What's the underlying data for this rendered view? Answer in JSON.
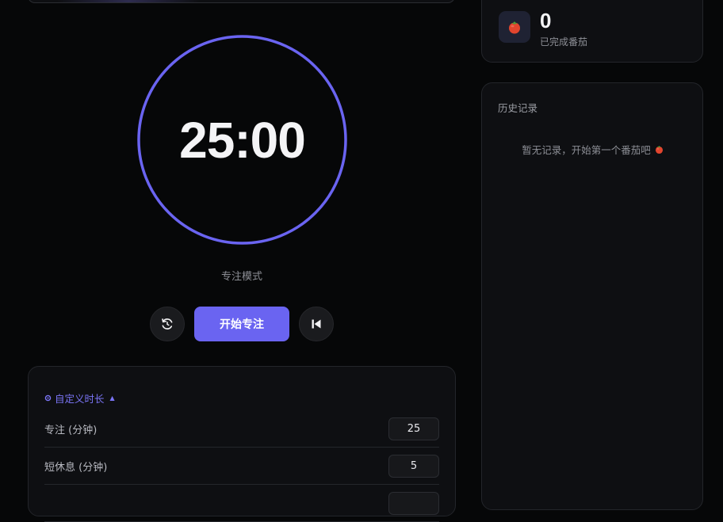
{
  "timer": {
    "display": "25:00",
    "mode_label": "专注模式",
    "progress": 1.0,
    "ring_color": "#6a64f1"
  },
  "controls": {
    "reset_icon": "reset-icon",
    "start_label": "开始专注",
    "skip_icon": "skip-back-icon"
  },
  "settings": {
    "toggle_label": "自定义时长",
    "toggle_icon": "gear-icon",
    "caret": "▲",
    "rows": [
      {
        "label": "专注 (分钟)",
        "value": "25"
      },
      {
        "label": "短休息 (分钟)",
        "value": "5"
      },
      {
        "label": "",
        "value": ""
      }
    ]
  },
  "stats": {
    "icon": "tomato-icon",
    "count": "0",
    "label": "已完成番茄"
  },
  "history": {
    "title": "历史记录",
    "empty_text": "暂无记录，开始第一个番茄吧",
    "empty_icon": "tomato-icon"
  },
  "colors": {
    "accent": "#6a64f1",
    "background": "#060708",
    "card": "#0e0f12"
  }
}
